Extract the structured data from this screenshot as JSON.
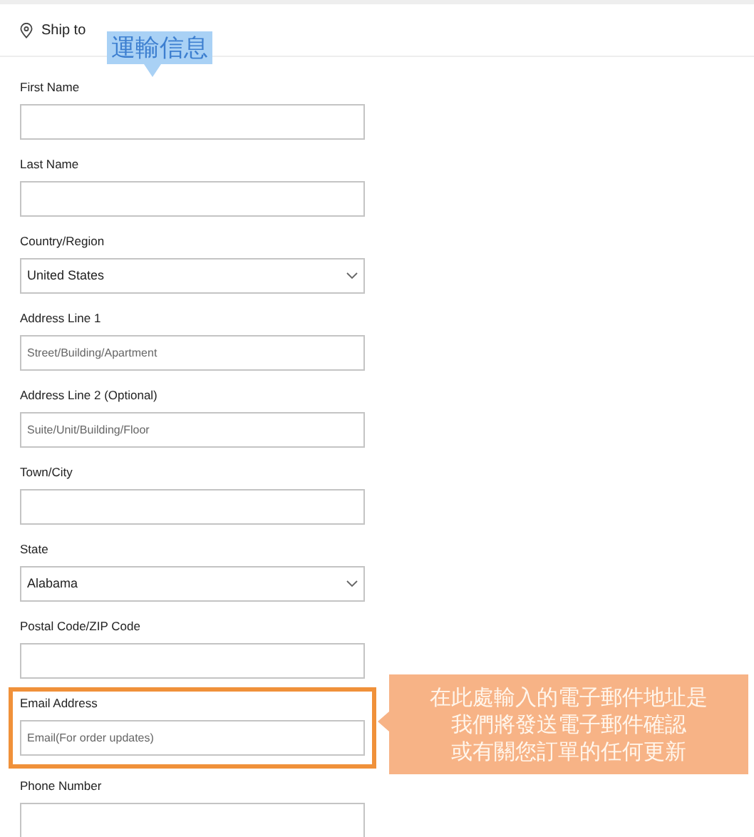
{
  "header": {
    "title": "Ship to"
  },
  "fields": [
    {
      "kind": "text",
      "label": "First Name",
      "highlighted": false
    },
    {
      "kind": "text",
      "label": "Last Name",
      "highlighted": false
    },
    {
      "kind": "select",
      "label": "Country/Region",
      "value": "United States",
      "highlighted": false
    },
    {
      "kind": "text",
      "label": "Address Line 1",
      "placeholder": "Street/Building/Apartment",
      "highlighted": false
    },
    {
      "kind": "text",
      "label": "Address Line 2 (Optional)",
      "placeholder": "Suite/Unit/Building/Floor",
      "highlighted": false
    },
    {
      "kind": "text",
      "label": "Town/City",
      "highlighted": false
    },
    {
      "kind": "select",
      "label": "State",
      "value": "Alabama",
      "highlighted": false
    },
    {
      "kind": "text",
      "label": "Postal Code/ZIP Code",
      "highlighted": false
    },
    {
      "kind": "text",
      "label": "Email Address",
      "placeholder": "Email(For order updates)",
      "highlighted": true
    },
    {
      "kind": "text",
      "label": "Phone Number",
      "highlighted": false
    }
  ],
  "annotations": [
    {
      "kind": "tip",
      "lines": [
        "運輸信息"
      ]
    },
    {
      "kind": "note",
      "lines": [
        "在此處輸入的電子郵件地址是",
        "我們將發送電子郵件確認",
        "或有關您訂單的任何更新"
      ]
    }
  ]
}
